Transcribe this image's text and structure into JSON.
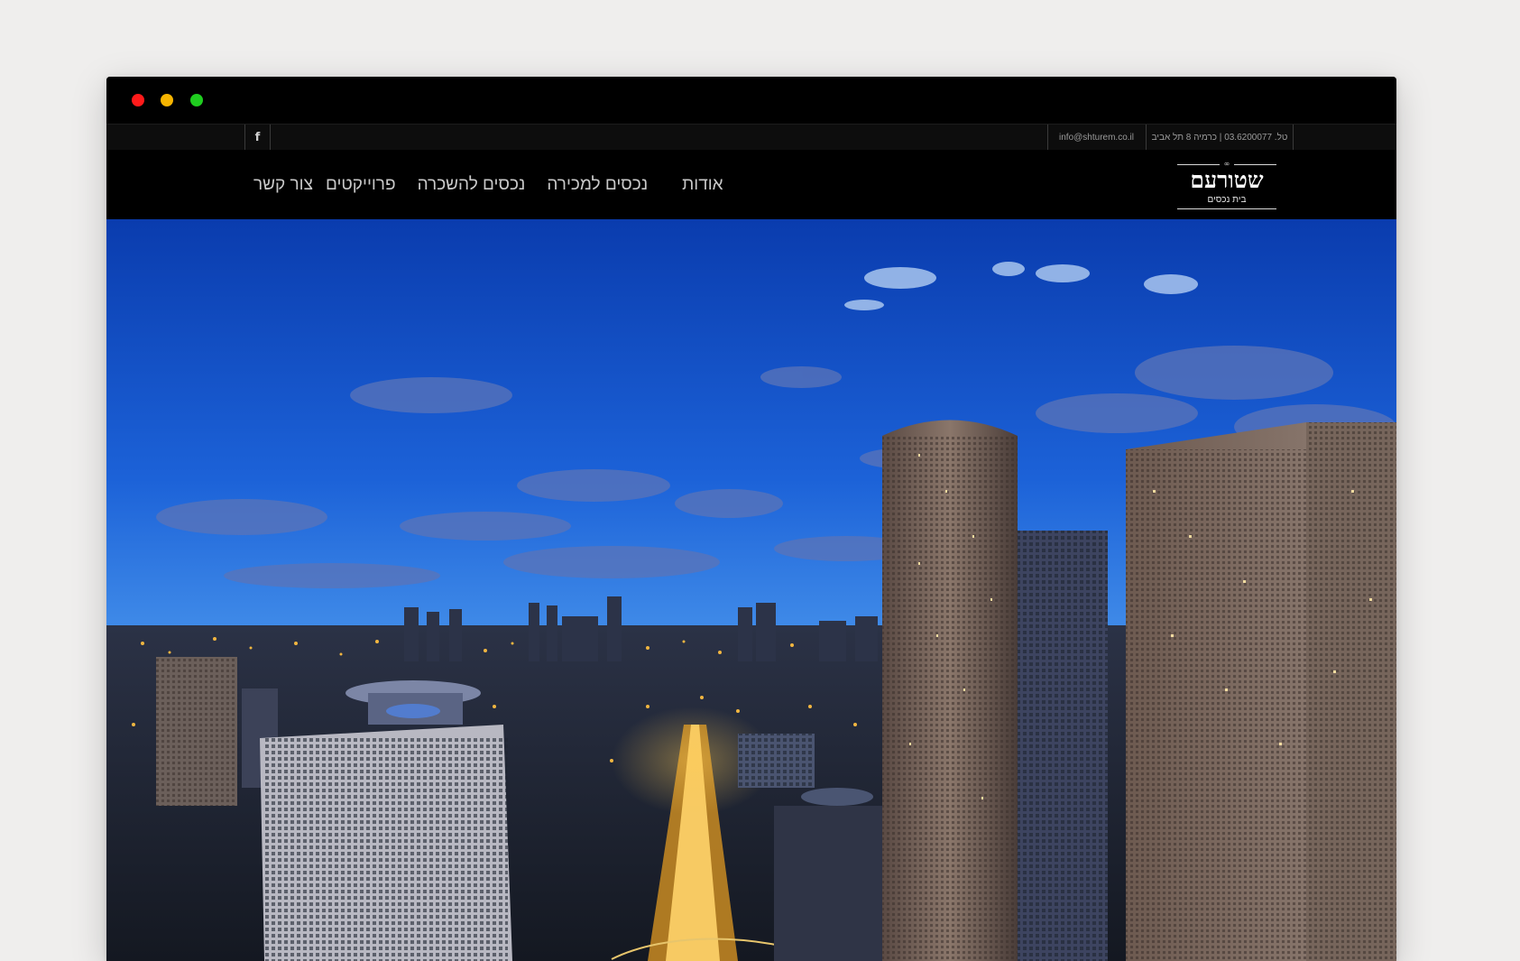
{
  "window": {
    "controls": [
      "close",
      "minimize",
      "maximize"
    ],
    "colors": {
      "close": "#ff1a1a",
      "minimize": "#f7b500",
      "maximize": "#1fcd1f"
    }
  },
  "topbar": {
    "social_icon": "facebook-icon",
    "social_glyph": "f",
    "email": "info@shturem.co.il",
    "contact": "טל. 03.6200077 | כרמיה 8 תל אביב"
  },
  "header": {
    "logo": {
      "name": "שטורעם",
      "subtitle": "בית נכסים"
    },
    "nav": [
      {
        "label": "אודות"
      },
      {
        "label": "נכסים למכירה"
      },
      {
        "label": "נכסים להשכרה"
      },
      {
        "label": "פרוייקטים"
      },
      {
        "label": "צור קשר"
      }
    ]
  },
  "hero": {
    "image": "night-city-skyline",
    "colors": {
      "sky_top": "#0c3fb0",
      "sky_mid": "#2f7fe6",
      "city_lights": "#f2b640"
    }
  }
}
